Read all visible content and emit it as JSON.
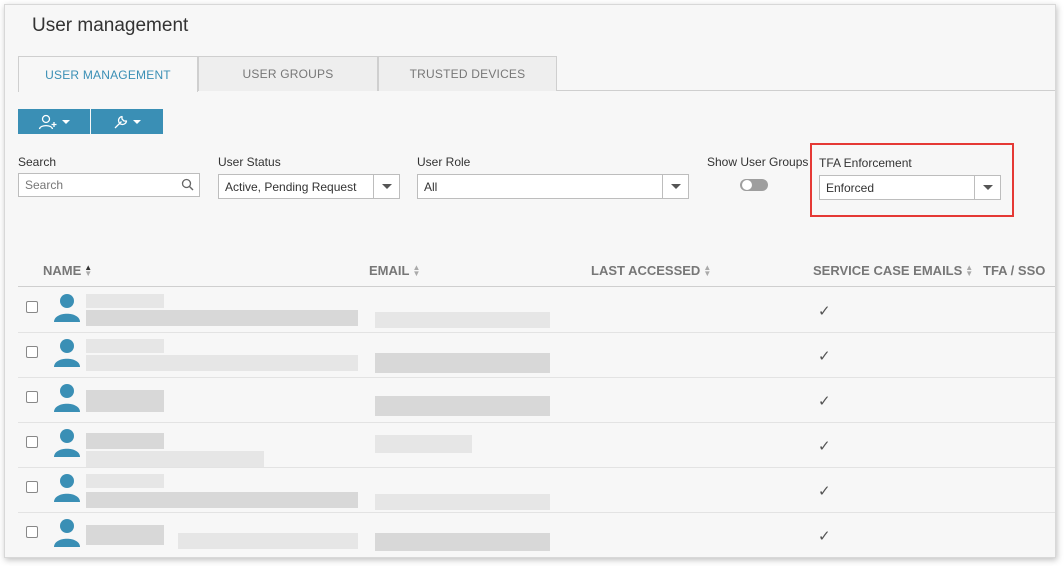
{
  "page": {
    "title": "User management"
  },
  "tabs": [
    {
      "label": "USER MANAGEMENT",
      "active": true
    },
    {
      "label": "USER GROUPS",
      "active": false
    },
    {
      "label": "TRUSTED DEVICES",
      "active": false
    }
  ],
  "toolbar": {
    "add_user_icon": "add-user-icon",
    "tools_icon": "wrench-icon"
  },
  "filters": {
    "search": {
      "label": "Search",
      "placeholder": "Search"
    },
    "user_status": {
      "label": "User Status",
      "value": "Active, Pending Request"
    },
    "user_role": {
      "label": "User Role",
      "value": "All"
    },
    "show_user_groups": {
      "label": "Show User Groups",
      "on": false
    },
    "tfa_enforcement": {
      "label": "TFA Enforcement",
      "value": "Enforced"
    }
  },
  "table": {
    "columns": [
      "NAME",
      "EMAIL",
      "LAST ACCESSED",
      "SERVICE CASE EMAILS",
      "TFA / SSO"
    ],
    "rows": [
      {
        "service_case_emails": "✓"
      },
      {
        "service_case_emails": "✓"
      },
      {
        "service_case_emails": "✓"
      },
      {
        "service_case_emails": "✓"
      },
      {
        "service_case_emails": "✓"
      },
      {
        "service_case_emails": "✓"
      }
    ]
  },
  "colors": {
    "accent": "#3a8fb5",
    "highlight": "#e53935"
  }
}
